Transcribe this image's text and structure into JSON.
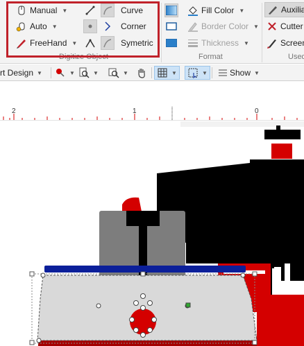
{
  "ribbon": {
    "digitize": {
      "manual_label": "Manual",
      "auto_label": "Auto",
      "freehand_label": "FreeHand",
      "curve_label": "Curve",
      "corner_label": "Corner",
      "symmetric_label": "Symetric",
      "group_label": "Digitize Object"
    },
    "format": {
      "fill_color_label": "Fill Color",
      "border_color_label": "Border Color",
      "thickness_label": "Thickness",
      "group_label": "Format"
    },
    "used": {
      "auxiliary_label": "Auxilia",
      "cutter_label": "Cutter",
      "screen_label": "Screen",
      "group_label": "Used"
    }
  },
  "toolbar": {
    "design_label": "rt Design",
    "show_label": "Show"
  },
  "ruler": {
    "ticks": [
      "2",
      "1",
      "0"
    ]
  },
  "colors": {
    "highlight": "#c0212a",
    "accent_red": "#d40000",
    "navy": "#0b1f9a",
    "gray": "#7d7d7d",
    "light_gray": "#d9d9d9"
  }
}
